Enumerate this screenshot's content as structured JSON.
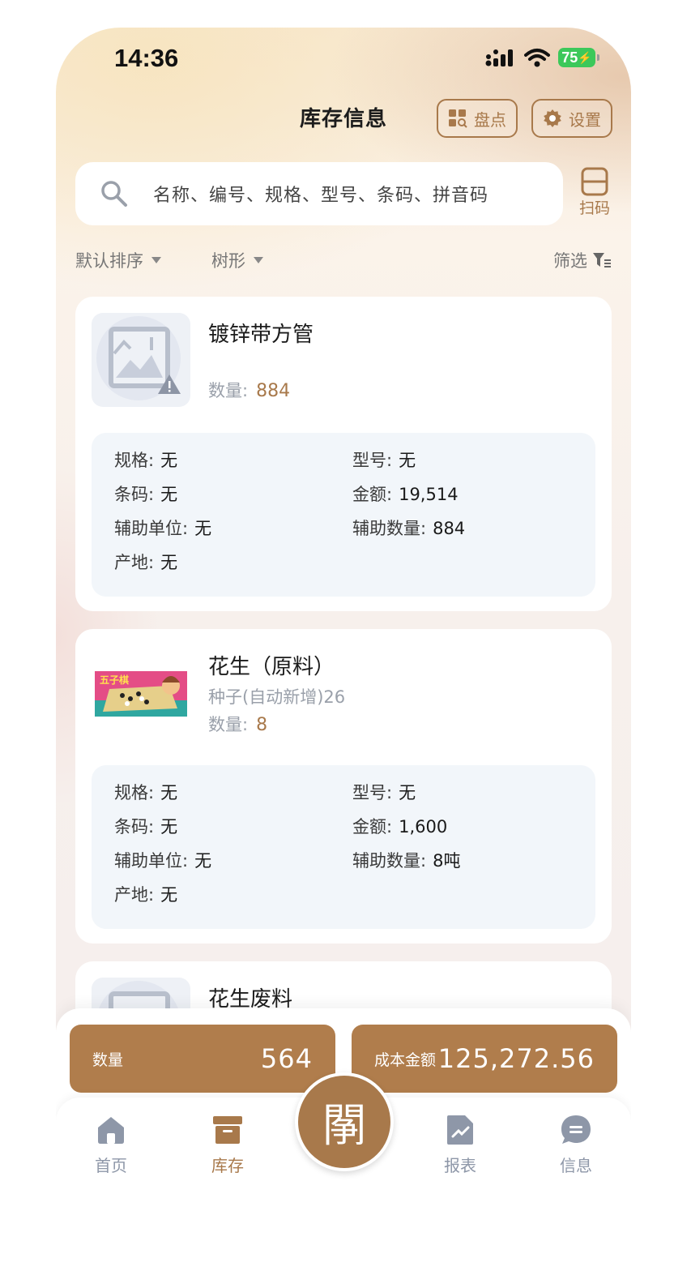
{
  "status": {
    "time": "14:36",
    "battery": "75"
  },
  "header": {
    "title": "库存信息",
    "count_btn": "盘点",
    "settings_btn": "设置"
  },
  "search": {
    "placeholder": "名称、编号、规格、型号、条码、拼音码",
    "scan_label": "扫码"
  },
  "sortbar": {
    "sort": "默认排序",
    "tree": "树形",
    "filter": "筛选"
  },
  "items": [
    {
      "name": "镀锌带方管",
      "qty_label": "数量:",
      "qty": "884",
      "details": {
        "spec_label": "规格:",
        "spec": "无",
        "model_label": "型号:",
        "model": "无",
        "barcode_label": "条码:",
        "barcode": "无",
        "amount_label": "金额:",
        "amount": "19,514",
        "aux_unit_label": "辅助单位:",
        "aux_unit": "无",
        "aux_qty_label": "辅助数量:",
        "aux_qty": "884",
        "origin_label": "产地:",
        "origin": "无"
      }
    },
    {
      "name": "花生（原料）",
      "subtitle": "种子(自动新增)26",
      "qty_label": "数量:",
      "qty": "8",
      "image_text": "五子棋",
      "details": {
        "spec_label": "规格:",
        "spec": "无",
        "model_label": "型号:",
        "model": "无",
        "barcode_label": "条码:",
        "barcode": "无",
        "amount_label": "金额:",
        "amount": "1,600",
        "aux_unit_label": "辅助单位:",
        "aux_unit": "无",
        "aux_qty_label": "辅助数量:",
        "aux_qty": "8吨",
        "origin_label": "产地:",
        "origin": "无"
      }
    },
    {
      "name": "花生废料"
    }
  ],
  "summary": {
    "qty_label": "数量",
    "qty": "564",
    "cost_label": "成本金额",
    "cost": "125,272.56"
  },
  "tabs": {
    "home": "首页",
    "inventory": "库存",
    "center": "䦛",
    "report": "报表",
    "messages": "信息"
  },
  "colors": {
    "accent": "#a8794b",
    "summary_bg": "#b07d4c",
    "tab_inactive": "#8e97a8"
  }
}
